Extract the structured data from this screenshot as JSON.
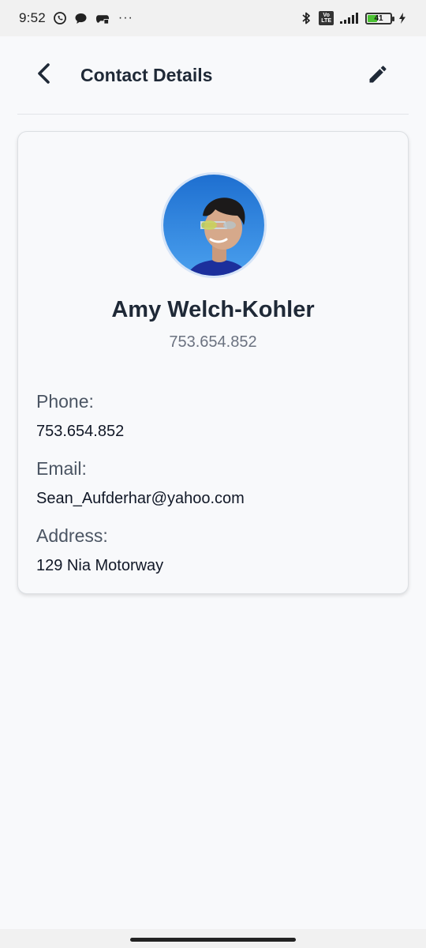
{
  "status_bar": {
    "time": "9:52",
    "more": "···",
    "battery_level": "41",
    "battery_fraction": 0.41,
    "volte": "Vo\nLTE",
    "battery_color": "#4cc233"
  },
  "header": {
    "title": "Contact Details",
    "back_icon": "chevron-left-icon",
    "edit_icon": "pencil-icon"
  },
  "contact": {
    "name": "Amy Welch-Kohler",
    "subtitle": "753.654.852",
    "fields": [
      {
        "label": "Phone:",
        "value": "753.654.852"
      },
      {
        "label": "Email:",
        "value": "Sean_Aufderhar@yahoo.com"
      },
      {
        "label": "Address:",
        "value": "129 Nia Motorway"
      }
    ]
  },
  "colors": {
    "background": "#f8f9fb",
    "title_text": "#1f2937",
    "label_text": "#4b5563",
    "muted_text": "#6b7280"
  }
}
